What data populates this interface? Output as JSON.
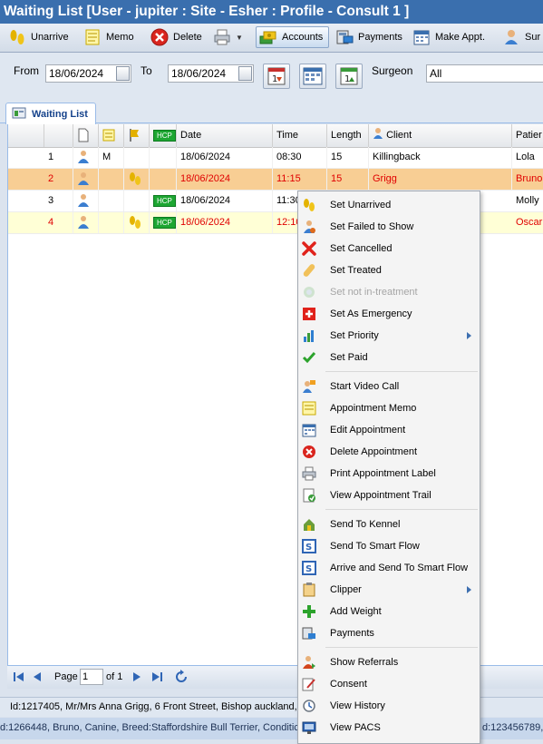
{
  "window": {
    "title": "Waiting List [User - jupiter : Site - Esher : Profile - Consult 1 ]"
  },
  "toolbar": {
    "unarrive": "Unarrive",
    "memo": "Memo",
    "delete": "Delete",
    "accounts": "Accounts",
    "payments": "Payments",
    "make_appt": "Make Appt.",
    "surgeon_partial": "Sur"
  },
  "filter": {
    "from_label": "From",
    "from_value": "18/06/2024",
    "to_label": "To",
    "to_value": "18/06/2024",
    "surgeon_label": "Surgeon",
    "surgeon_value": "All"
  },
  "tab": {
    "label": "Waiting List"
  },
  "grid": {
    "columns": {
      "hcp": "HCP",
      "date": "Date",
      "time": "Time",
      "length": "Length",
      "client": "Client",
      "patient": "Patier"
    },
    "rows": [
      {
        "num": "1",
        "memo": "M",
        "hcp": "",
        "date": "18/06/2024",
        "time": "08:30",
        "length": "15",
        "client": "Killingback",
        "patient": "Lola"
      },
      {
        "num": "2",
        "memo": "",
        "hcp": "",
        "date": "18/06/2024",
        "time": "11:15",
        "length": "15",
        "client": "Grigg",
        "patient": "Bruno"
      },
      {
        "num": "3",
        "memo": "",
        "hcp": "HCP",
        "date": "18/06/2024",
        "time": "11:30",
        "length": "",
        "client": "",
        "patient": "Molly"
      },
      {
        "num": "4",
        "memo": "",
        "hcp": "HCP",
        "date": "18/06/2024",
        "time": "12:10",
        "length": "",
        "client": "",
        "patient": "Oscar"
      }
    ]
  },
  "pager": {
    "page_label": "Page",
    "page_value": "1",
    "of_label": "of 1"
  },
  "status": {
    "client_info": "Id:1217405, Mr/Mrs Anna Grigg, 6 Front Street, Bishop auckland,",
    "patient_info": "d:1266448, Bruno, Canine, Breed:Staffordshire Bull Terrier, Conditic",
    "patient_info_right": "d:123456789,"
  },
  "menu": {
    "set_unarrived": "Set Unarrived",
    "set_failed": "Set Failed to Show",
    "set_cancelled": "Set Cancelled",
    "set_treated": "Set Treated",
    "set_not_in_treatment": "Set not in-treatment",
    "set_emergency": "Set As Emergency",
    "set_priority": "Set Priority",
    "set_paid": "Set Paid",
    "start_video": "Start Video Call",
    "appt_memo": "Appointment Memo",
    "edit_appt": "Edit Appointment",
    "delete_appt": "Delete Appointment",
    "print_label": "Print Appointment Label",
    "view_trail": "View Appointment Trail",
    "send_kennel": "Send To Kennel",
    "send_smart": "Send To Smart Flow",
    "arrive_smart": "Arrive and Send To Smart Flow",
    "clipper": "Clipper",
    "add_weight": "Add Weight",
    "payments": "Payments",
    "show_referrals": "Show Referrals",
    "consent": "Consent",
    "view_history": "View History",
    "view_pacs": "View PACS"
  },
  "colors": {
    "title_bar": "#3a6fae",
    "selected_row": "#f8ce94",
    "highlight_row": "#ffffd6",
    "late_text": "#e00000",
    "hcp_badge": "#1da632"
  }
}
